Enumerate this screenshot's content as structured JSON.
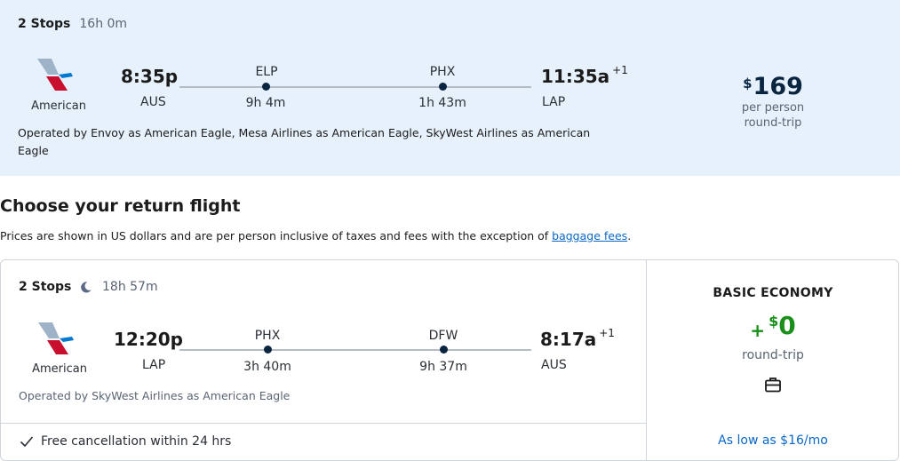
{
  "outbound": {
    "stops": "2 Stops",
    "duration": "16h 0m",
    "airline": "American",
    "depart_time": "8:35p",
    "depart_code": "AUS",
    "arrive_time": "11:35a",
    "arrive_day_offset": "+1",
    "arrive_code": "LAP",
    "layovers": [
      {
        "code": "ELP",
        "duration": "9h 4m"
      },
      {
        "code": "PHX",
        "duration": "1h 43m"
      }
    ],
    "operated_line1": "Operated by Envoy as American Eagle, Mesa Airlines as American Eagle, SkyWest Airlines as American",
    "operated_line2": "Eagle",
    "price_currency": "$",
    "price_amount": "169",
    "price_sub1": "per person",
    "price_sub2": "round-trip"
  },
  "return_section": {
    "title": "Choose your return flight",
    "disclaimer_text": "Prices are shown in US dollars and are per person inclusive of taxes and fees with the exception of ",
    "disclaimer_link": "baggage fees",
    "disclaimer_end": "."
  },
  "return_flight": {
    "stops": "2 Stops",
    "overnight_icon": "moon-icon",
    "duration": "18h 57m",
    "airline": "American",
    "depart_time": "12:20p",
    "depart_code": "LAP",
    "arrive_time": "8:17a",
    "arrive_day_offset": "+1",
    "arrive_code": "AUS",
    "layovers": [
      {
        "code": "PHX",
        "duration": "3h 40m"
      },
      {
        "code": "DFW",
        "duration": "9h 37m"
      }
    ],
    "operated": "Operated by SkyWest Airlines as American Eagle",
    "free_cancel": "Free cancellation within 24 hrs",
    "fare_name": "BASIC ECONOMY",
    "fare_plus": "+",
    "fare_currency": "$",
    "fare_amount": "0",
    "fare_sub": "round-trip",
    "bag_icon": "suitcase-icon",
    "as_low_as": "As low as $16/mo"
  },
  "colors": {
    "selected_bg": "#e7f1fc",
    "price_navy": "#0a2540",
    "fare_green": "#1a8f1a",
    "link_blue": "#0b67c7"
  }
}
